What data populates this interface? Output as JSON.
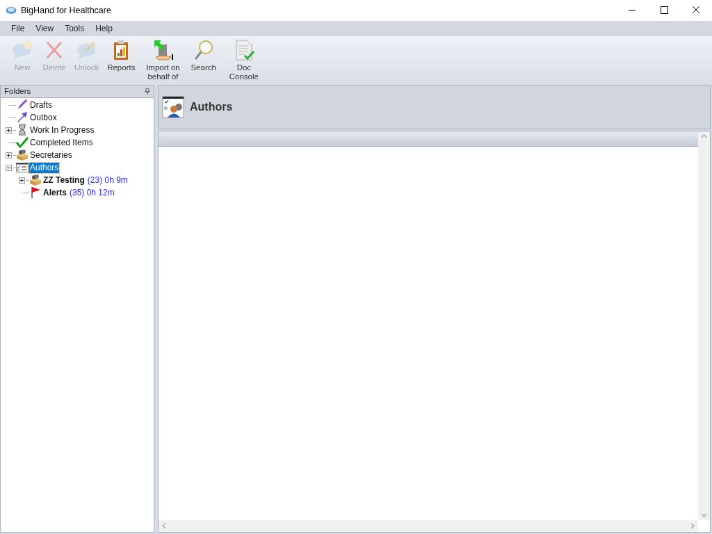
{
  "window": {
    "title": "BigHand for Healthcare"
  },
  "menu": [
    "File",
    "View",
    "Tools",
    "Help"
  ],
  "toolbar": [
    {
      "label": "New",
      "disabled": true
    },
    {
      "label": "Delete",
      "disabled": true
    },
    {
      "label": "Unlock",
      "disabled": true
    },
    {
      "label": "Reports",
      "disabled": false
    },
    {
      "label": "Import on behalf of",
      "disabled": false
    },
    {
      "label": "Search",
      "disabled": false
    },
    {
      "label": "Doc Console",
      "disabled": false
    }
  ],
  "folders": {
    "title": "Folders",
    "items": [
      {
        "label": "Drafts",
        "selected": false
      },
      {
        "label": "Outbox",
        "selected": false
      },
      {
        "label": "Work In Progress",
        "selected": false,
        "expanded": false
      },
      {
        "label": "Completed Items",
        "selected": false
      },
      {
        "label": "Secretaries",
        "selected": false,
        "expanded": false
      },
      {
        "label": "Authors",
        "selected": true,
        "expanded": true,
        "children": [
          {
            "label": "ZZ Testing",
            "count": "(23) 0h 9m",
            "selected": false,
            "expanded": false
          },
          {
            "label": "Alerts",
            "count": "(35) 0h 12m",
            "selected": false
          }
        ]
      }
    ]
  },
  "content": {
    "title": "Authors"
  }
}
